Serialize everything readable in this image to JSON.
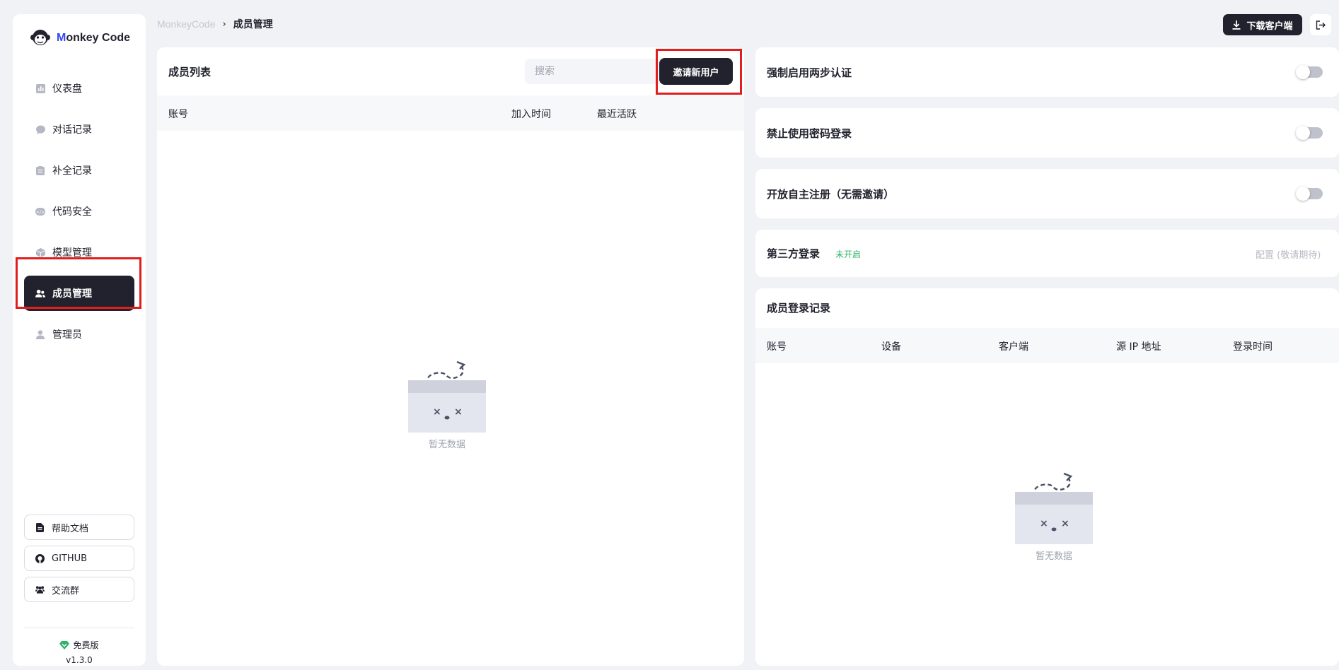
{
  "app": {
    "brand_prefix": "M",
    "brand_rest": "onkey Code"
  },
  "sidebar": {
    "items": [
      {
        "label": "仪表盘",
        "icon": "dashboard-icon"
      },
      {
        "label": "对话记录",
        "icon": "chat-icon"
      },
      {
        "label": "补全记录",
        "icon": "clipboard-icon"
      },
      {
        "label": "代码安全",
        "icon": "shield-icon"
      },
      {
        "label": "模型管理",
        "icon": "cube-icon"
      },
      {
        "label": "成员管理",
        "icon": "users-icon",
        "active": true
      },
      {
        "label": "管理员",
        "icon": "admin-icon"
      }
    ],
    "links": [
      {
        "label": "帮助文档",
        "icon": "document-icon"
      },
      {
        "label": "GITHUB",
        "icon": "github-icon"
      },
      {
        "label": "交流群",
        "icon": "group-icon"
      }
    ],
    "plan": "免费版",
    "version": "v1.3.0"
  },
  "header": {
    "breadcrumb_root": "MonkeyCode",
    "breadcrumb_sep": "›",
    "breadcrumb_current": "成员管理",
    "download_label": "下载客户端"
  },
  "member_list": {
    "title": "成员列表",
    "search_placeholder": "搜索",
    "invite_label": "邀请新用户",
    "columns": [
      "账号",
      "加入时间",
      "最近活跃"
    ],
    "empty_text": "暂无数据"
  },
  "settings": [
    {
      "label": "强制启用两步认证",
      "enabled": false
    },
    {
      "label": "禁止使用密码登录",
      "enabled": false
    },
    {
      "label": "开放自主注册（无需邀请）",
      "enabled": false
    }
  ],
  "third_party": {
    "label": "第三方登录",
    "status": "未开启",
    "config_label": "配置 (敬请期待)"
  },
  "login_log": {
    "title": "成员登录记录",
    "columns": [
      "账号",
      "设备",
      "客户端",
      "源 IP 地址",
      "登录时间"
    ],
    "empty_text": "暂无数据"
  },
  "colors": {
    "accent_dark": "#21222d",
    "brand_blue": "#3248f2",
    "status_green": "#2fb36b",
    "highlight_red": "#e01e1e"
  }
}
